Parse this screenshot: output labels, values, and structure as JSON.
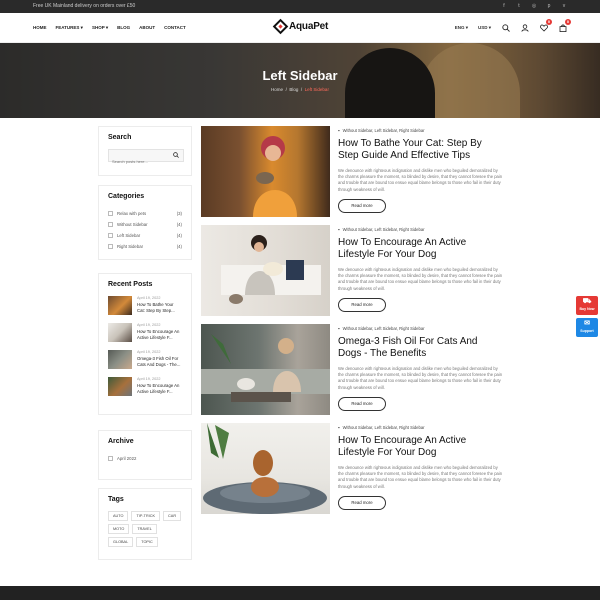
{
  "topbar": {
    "promo": "Free UK Mainland delivery on orders over £50",
    "social_icons": [
      "facebook-icon",
      "twitter-icon",
      "instagram-icon",
      "pinterest-icon",
      "vimeo-icon"
    ]
  },
  "header": {
    "nav": [
      "HOME",
      "FEATURES",
      "SHOP",
      "BLOG",
      "ABOUT",
      "CONTACT"
    ],
    "logo": "AquaPet",
    "language": "ENG",
    "currency": "USD",
    "wishlist_count": "0",
    "cart_count": "0"
  },
  "hero": {
    "title": "Left Sidebar",
    "breadcrumb": [
      "Home",
      "Blog",
      "Left Sidebar"
    ],
    "sep": "/"
  },
  "sidebar": {
    "search": {
      "title": "Search",
      "placeholder": "Search posts here..."
    },
    "categories": {
      "title": "Categories",
      "items": [
        {
          "label": "Relax with pets",
          "count": "(3)"
        },
        {
          "label": "Without Sidebar",
          "count": "(4)"
        },
        {
          "label": "Left Sidebar",
          "count": "(4)"
        },
        {
          "label": "Right Sidebar",
          "count": "(4)"
        }
      ]
    },
    "recent": {
      "title": "Recent Posts",
      "items": [
        {
          "date": "April 19, 2022",
          "title": "How To Bathe Your Cat: Step By Step..."
        },
        {
          "date": "April 19, 2022",
          "title": "How To Encourage An Active Lifestyle F..."
        },
        {
          "date": "April 19, 2022",
          "title": "Omega-3 Fish Oil For Cats And Dogs - The..."
        },
        {
          "date": "April 19, 2022",
          "title": "How To Encourage An Active Lifestyle F..."
        }
      ]
    },
    "archive": {
      "title": "Archive",
      "items": [
        "April 2022"
      ]
    },
    "tags": {
      "title": "Tags",
      "items": [
        "AUTO",
        "TIP-TRICK",
        "CAR",
        "MOTO",
        "TRAVEL",
        "GLOBAL",
        "TOPIC"
      ]
    }
  },
  "posts": [
    {
      "categories": "Without Sidebar, Left Sidebar, Right Sidebar",
      "title": "How To Bathe Your Cat: Step By Step Guide And Effective Tips",
      "excerpt": "We denounce with righteous indignation and dislike men who beguiled demoralized by the charms pleasure the moment, so blinded by desire, that they cannot foresee the pain and trouble that are bound too ensue equal blame belongs to those who fail in their duty through weakness of will.",
      "button": "Read more"
    },
    {
      "categories": "Without Sidebar, Left Sidebar, Right Sidebar",
      "title": "How To Encourage An Active Lifestyle For Your Dog",
      "excerpt": "We denounce with righteous indignation and dislike men who beguiled demoralized by the charms pleasure the moment, so blinded by desire, that they cannot foresee the pain and trouble that are bound too ensue equal blame belongs to those who fail in their duty through weakness of will.",
      "button": "Read more"
    },
    {
      "categories": "Without Sidebar, Left Sidebar, Right Sidebar",
      "title": "Omega-3 Fish Oil For Cats And Dogs - The Benefits",
      "excerpt": "We denounce with righteous indignation and dislike men who beguiled demoralized by the charms pleasure the moment, so blinded by desire, that they cannot foresee the pain and trouble that are bound too ensue equal blame belongs to those who fail in their duty through weakness of will.",
      "button": "Read more"
    },
    {
      "categories": "Without Sidebar, Left Sidebar, Right Sidebar",
      "title": "How To Encourage An Active Lifestyle For Your Dog",
      "excerpt": "We denounce with righteous indignation and dislike men who beguiled demoralized by the charms pleasure the moment, so blinded by desire, that they cannot foresee the pain and trouble that are bound too ensue equal blame belongs to those who fail in their duty through weakness of will.",
      "button": "Read more"
    }
  ],
  "floating": {
    "buy": "Buy Now",
    "support": "Support"
  },
  "colors": {
    "accent": "#e53935",
    "support": "#1e88e5",
    "topbar": "#2a2a2a",
    "footer": "#222222"
  }
}
